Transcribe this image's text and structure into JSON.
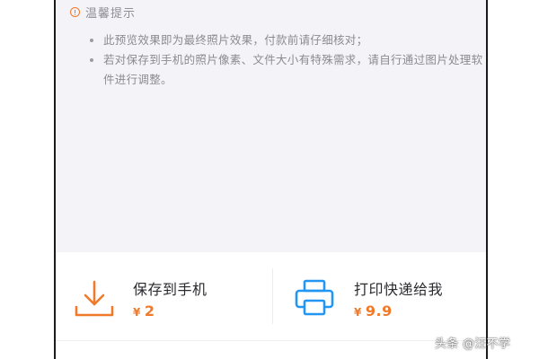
{
  "notice": {
    "title": "温馨提示",
    "tips": [
      "此预览效果即为最终照片效果，付款前请仔细核对；",
      "若对保存到手机的照片像素、文件大小有特殊需求，请自行通过图片处理软件进行调整。"
    ]
  },
  "options": [
    {
      "label": "保存到手机",
      "currency": "¥",
      "price": "2",
      "icon": "download-icon"
    },
    {
      "label": "打印快递给我",
      "currency": "¥",
      "price": "9.9",
      "icon": "printer-icon"
    }
  ],
  "watermark": "头条 @汪不学",
  "colors": {
    "accent": "#f07a2a",
    "icon_blue": "#2196f3",
    "notice_bg": "#f3f3f8"
  }
}
